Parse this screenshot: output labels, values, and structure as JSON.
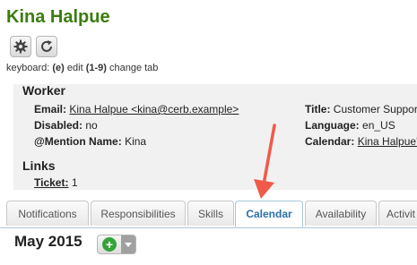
{
  "record": {
    "title": "Kina Halpue"
  },
  "toolbar": {
    "settings_icon": "gear-icon",
    "refresh_icon": "refresh-icon"
  },
  "keyboard": {
    "prefix": "keyboard: ",
    "edit_key": "(e)",
    "edit_label": " edit ",
    "tab_keys": "(1-9)",
    "tab_label": " change tab"
  },
  "worker": {
    "heading": "Worker",
    "email_label": "Email:",
    "email_value": "Kina Halpue <kina@cerb.example>",
    "disabled_label": "Disabled:",
    "disabled_value": "no",
    "mention_label": "@Mention Name:",
    "mention_value": "Kina",
    "title_label": "Title:",
    "title_value": "Customer Suppor",
    "language_label": "Language:",
    "language_value": "en_US",
    "calendar_label": "Calendar:",
    "calendar_value": "Kina Halpue'"
  },
  "links": {
    "heading": "Links",
    "ticket_label": "Ticket:",
    "ticket_count": "1"
  },
  "tabs": [
    {
      "label": "Notifications"
    },
    {
      "label": "Responsibilities"
    },
    {
      "label": "Skills"
    },
    {
      "label": "Calendar"
    },
    {
      "label": "Availability"
    },
    {
      "label": "Activit"
    }
  ],
  "active_tab": "Calendar",
  "calendar": {
    "month_label": "May 2015",
    "add_icon": "plus-circle-icon",
    "menu_icon": "chevron-down-icon"
  },
  "colors": {
    "title_green": "#3b7d0e",
    "active_tab_blue": "#2a6fa8",
    "arrow_red": "#f05a4a",
    "add_green": "#35a33a"
  }
}
